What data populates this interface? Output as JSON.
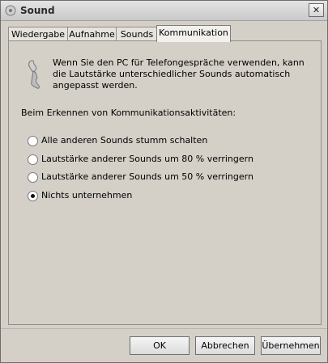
{
  "window": {
    "title": "Sound"
  },
  "tabs": [
    {
      "label": "Wiedergabe",
      "active": false
    },
    {
      "label": "Aufnahme",
      "active": false
    },
    {
      "label": "Sounds",
      "active": false
    },
    {
      "label": "Kommunikation",
      "active": true
    }
  ],
  "communication": {
    "intro": "Wenn Sie den PC für Telefongespräche verwenden, kann die Lautstärke unterschiedlicher Sounds automatisch angepasst werden.",
    "section_label": "Beim Erkennen von Kommunikationsaktivitäten:",
    "options": [
      {
        "label": "Alle anderen Sounds stumm schalten",
        "selected": false
      },
      {
        "label": "Lautstärke anderer Sounds um 80 % verringern",
        "selected": false
      },
      {
        "label": "Lautstärke anderer Sounds um 50 % verringern",
        "selected": false
      },
      {
        "label": "Nichts unternehmen",
        "selected": true
      }
    ]
  },
  "buttons": {
    "ok": "OK",
    "cancel": "Abbrechen",
    "apply": "Übernehmen"
  },
  "icons": {
    "app": "speaker-icon",
    "phone": "phone-handset-icon",
    "close": "close-icon"
  }
}
